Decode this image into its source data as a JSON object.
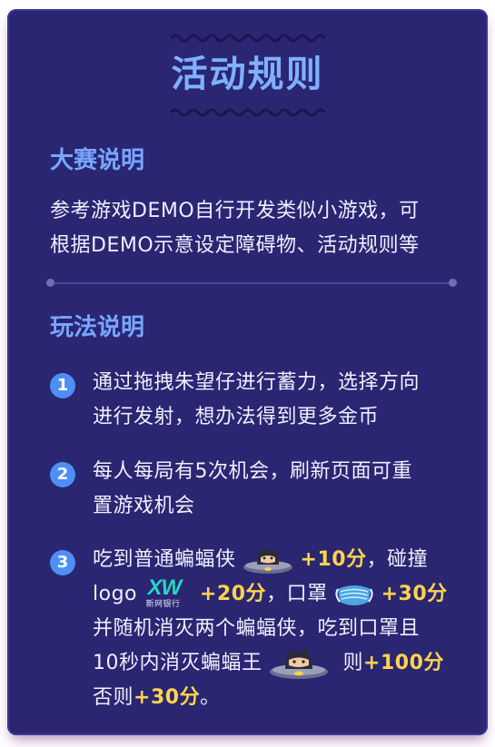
{
  "title": "活动规则",
  "sections": {
    "intro": {
      "heading": "大赛说明",
      "lines": [
        "参考游戏DEMO自行开发类似小游戏，可",
        "根据DEMO示意设定障碍物、活动规则等"
      ]
    },
    "rules": {
      "heading": "玩法说明",
      "items": [
        {
          "number": "1",
          "lines": [
            "通过拖拽朱望仔进行蓄力，选择方向",
            "进行发射，想办法得到更多金币"
          ]
        },
        {
          "number": "2",
          "lines": [
            "每人每局有5次机会，刷新页面可重",
            "置游戏机会"
          ]
        },
        {
          "number": "3",
          "eat_normal": "吃到普通蝙蝠侠",
          "plus10": "+10分",
          "collide": "，碰撞",
          "logo_word": "logo",
          "logo_text": "XW",
          "logo_sub": "新网银行",
          "plus20": "+20分",
          "mask_word": "，口罩",
          "plus30": "+30分",
          "line3": "并随机消灭两个蝙蝠侠，吃到口罩且",
          "line4a": "10秒内消灭蝙蝠王",
          "line4b": "则",
          "plus100": "+100分",
          "line5a": "否则",
          "plus30b": "+30分",
          "line5b": "。"
        }
      ]
    }
  },
  "colors": {
    "background": "#2a2672",
    "heading": "#78a6ff",
    "text": "#eef0ff",
    "highlight": "#ffd34d",
    "badge": "#4e8ff5",
    "logo": "#27d6c3"
  },
  "icons": [
    "batman-ufo-icon",
    "xw-logo-icon",
    "face-mask-icon",
    "batman-king-ufo-icon"
  ]
}
